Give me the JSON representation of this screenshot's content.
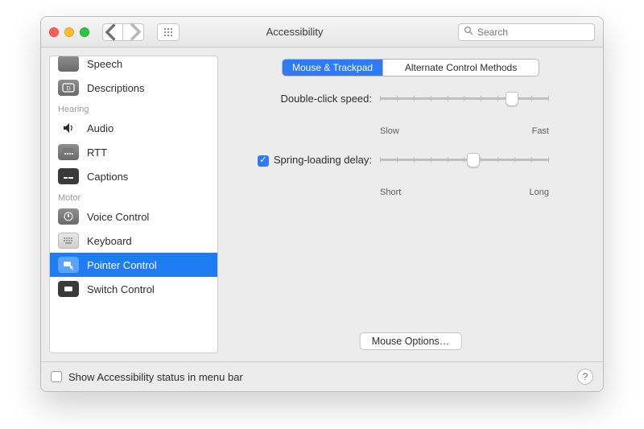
{
  "window": {
    "title": "Accessibility"
  },
  "search": {
    "placeholder": "Search"
  },
  "sidebar": {
    "sections": [
      {
        "label": "",
        "items": [
          {
            "id": "speech",
            "label": "Speech",
            "icon": "speech-bubble"
          },
          {
            "id": "descriptions",
            "label": "Descriptions",
            "icon": "descriptions"
          }
        ]
      },
      {
        "label": "Hearing",
        "items": [
          {
            "id": "audio",
            "label": "Audio",
            "icon": "speaker"
          },
          {
            "id": "rtt",
            "label": "RTT",
            "icon": "rtt"
          },
          {
            "id": "captions",
            "label": "Captions",
            "icon": "captions"
          }
        ]
      },
      {
        "label": "Motor",
        "items": [
          {
            "id": "voice-control",
            "label": "Voice Control",
            "icon": "voice-control"
          },
          {
            "id": "keyboard",
            "label": "Keyboard",
            "icon": "keyboard"
          },
          {
            "id": "pointer-control",
            "label": "Pointer Control",
            "icon": "pointer",
            "selected": true
          },
          {
            "id": "switch-control",
            "label": "Switch Control",
            "icon": "switch"
          }
        ]
      }
    ]
  },
  "tabs": {
    "items": [
      {
        "id": "mouse-trackpad",
        "label": "Mouse & Trackpad",
        "active": true
      },
      {
        "id": "alt-methods",
        "label": "Alternate Control Methods",
        "active": false
      }
    ]
  },
  "settings": {
    "double_click": {
      "label": "Double-click speed:",
      "min_label": "Slow",
      "max_label": "Fast",
      "value_pct": 78
    },
    "spring_loading": {
      "label": "Spring-loading delay:",
      "checked": true,
      "min_label": "Short",
      "max_label": "Long",
      "value_pct": 55
    },
    "mouse_options_label": "Mouse Options…"
  },
  "footer": {
    "show_status_label": "Show Accessibility status in menu bar",
    "show_status_checked": false
  }
}
